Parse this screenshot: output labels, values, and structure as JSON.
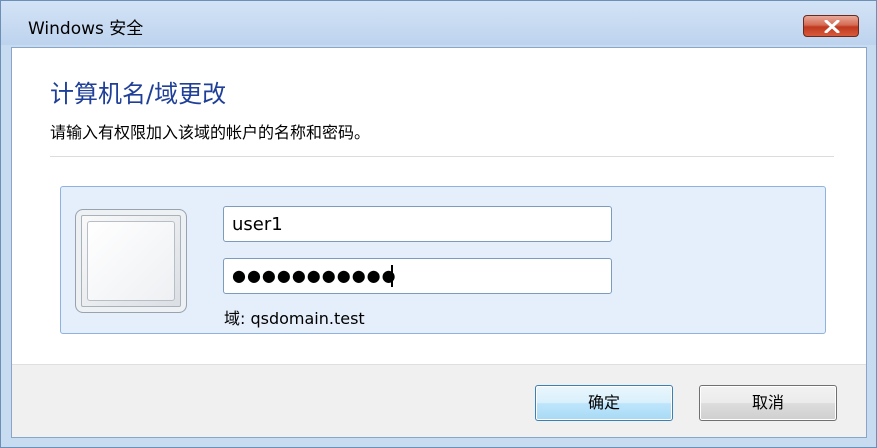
{
  "window": {
    "title": "Windows 安全",
    "close_icon": "close-icon"
  },
  "dialog": {
    "heading": "计算机名/域更改",
    "instruction": "请输入有权限加入该域的帐户的名称和密码。"
  },
  "credentials": {
    "username_value": "user1",
    "password_masked": "●●●●●●●●●●●",
    "domain_label": "域: qsdomain.test",
    "avatar_icon": "user-tile-icon"
  },
  "buttons": {
    "ok_label": "确定",
    "cancel_label": "取消"
  },
  "colors": {
    "heading": "#1f3f99",
    "close_button": "#c0391f",
    "tile_background": "#e5eefb"
  }
}
